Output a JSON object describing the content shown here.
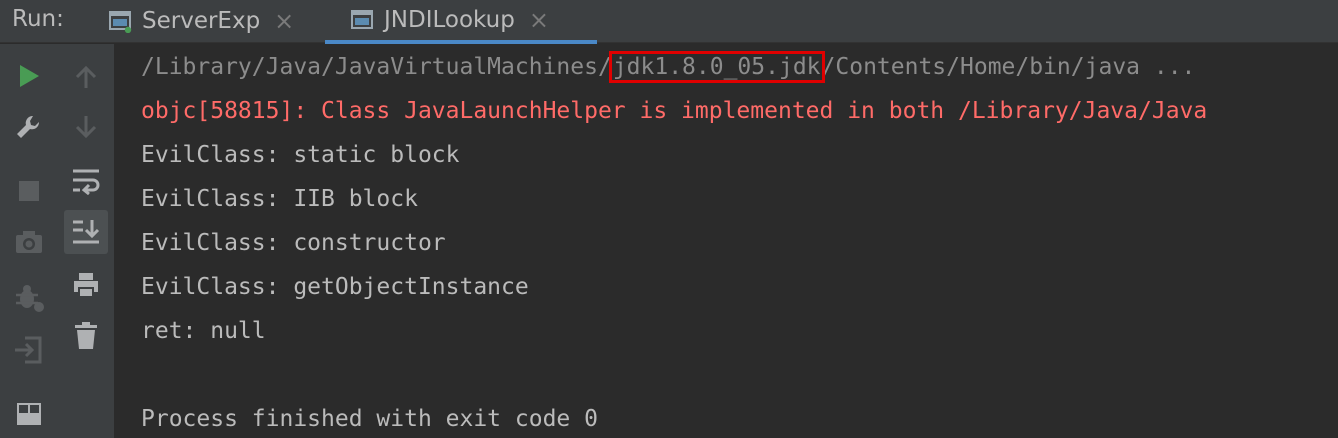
{
  "run_label": "Run:",
  "tabs": [
    {
      "label": "ServerExp",
      "icon": "console-window-icon",
      "active": false
    },
    {
      "label": "JNDILookup",
      "icon": "console-window-icon",
      "active": true
    }
  ],
  "close_glyph": "×",
  "console": {
    "path_prefix": "/Library/Java/JavaVirtualMachines/",
    "path_highlight": "jdk1.8.0_05.jdk",
    "path_suffix": "/Contents/Home/bin/java ...",
    "error_line": "objc[58815]: Class JavaLaunchHelper is implemented in both /Library/Java/Java",
    "lines": [
      "EvilClass: static block",
      "EvilClass: IIB block",
      "EvilClass: constructor",
      "EvilClass: getObjectInstance",
      "ret: null",
      "",
      "Process finished with exit code 0"
    ]
  },
  "colors": {
    "run_green": "#499c54",
    "error_red": "#ff6b68",
    "highlight_red": "#e00000",
    "active_tab_blue": "#4a88c7"
  },
  "toolbar_icons": {
    "left": [
      "run-icon",
      "wrench-icon",
      "stop-icon",
      "camera-icon",
      "debug-bug-icon",
      "exit-icon",
      "layout-icon"
    ],
    "right": [
      "arrow-up-icon",
      "arrow-down-icon",
      "soft-wrap-icon",
      "scroll-to-end-icon",
      "print-icon",
      "trash-icon"
    ]
  }
}
